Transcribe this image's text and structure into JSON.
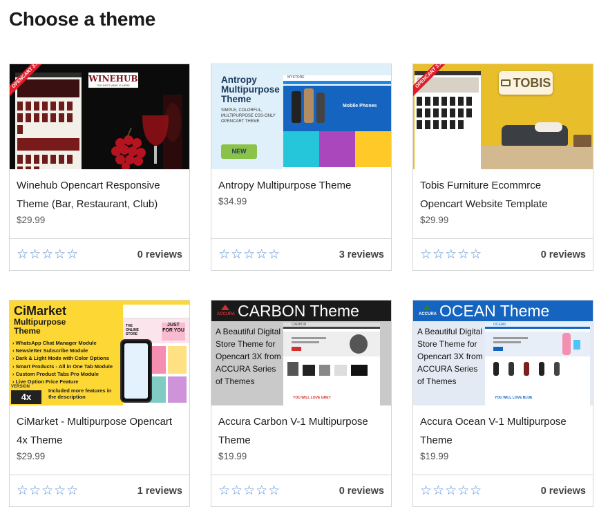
{
  "page": {
    "title": "Choose a theme"
  },
  "themes": [
    {
      "name": "Winehub Opencart Responsive Theme (Bar, Restaurant, Club)",
      "price": "$29.99",
      "stars": "☆☆☆☆☆",
      "reviews": "0 reviews",
      "thumb": {
        "brand": "WINEHUB",
        "tagline": "THE BEST WINE IS HERE",
        "ribbon": "OPENCART 3.X"
      }
    },
    {
      "name": "Antropy Multipurpose Theme",
      "price": "$34.99",
      "stars": "☆☆☆☆☆",
      "reviews": "3 reviews",
      "thumb": {
        "heading": "Antropy Multipurpose Theme",
        "sub": "SIMPLE, COLORFUL, MULTIPURPOSE CSS-ONLY OPENCART THEME",
        "badge": "NEW",
        "banner": "Mobile Phones",
        "logo": "MYSTORE"
      }
    },
    {
      "name": "Tobis Furniture Ecommrce Opencart Website Template",
      "price": "$29.99",
      "stars": "☆☆☆☆☆",
      "reviews": "0 reviews",
      "thumb": {
        "brand": "TOBIS",
        "ribbon": "OPENCART 3.X"
      }
    },
    {
      "name": "CiMarket - Multipurpose Opencart 4x Theme",
      "price": "$29.99",
      "stars": "☆☆☆☆☆",
      "reviews": "1 reviews",
      "thumb": {
        "brand": "CiMarket",
        "sub": "Multipurpose Theme",
        "features": [
          "WhatsApp Chat Manager Module",
          "Newsletter Subscribe Module",
          "Dark & Light Mode with Color Options",
          "Smart Products - All in One Tab Module",
          "Custom Product Tabs Pro Module",
          "Live Option Price Feature"
        ],
        "version_label": "VERSION",
        "version": "4x",
        "more": "Included more features in the description",
        "promo1": "THE ONLINE STORE",
        "promo2": "JUST FOR YOU"
      }
    },
    {
      "name": "Accura Carbon V-1 Multipurpose Theme",
      "price": "$19.99",
      "stars": "☆☆☆☆☆",
      "reviews": "0 reviews",
      "thumb": {
        "maker": "ACCURA",
        "title": "CARBON Theme",
        "desc": "A Beautiful Digital Store Theme for Opencart 3X from ACCURA Series of Themes",
        "store": "CARBON",
        "footer": "YOU WILL LOVE GREY"
      }
    },
    {
      "name": "Accura Ocean V-1 Multipurpose Theme",
      "price": "$19.99",
      "stars": "☆☆☆☆☆",
      "reviews": "0 reviews",
      "thumb": {
        "maker": "ACCURA",
        "title": "OCEAN Theme",
        "desc": "A Beautiful Digital Store Theme for Opencart 3X from ACCURA Series of Themes",
        "store": "OCEAN",
        "footer": "YOU WILL LOVE BLUE"
      }
    }
  ]
}
